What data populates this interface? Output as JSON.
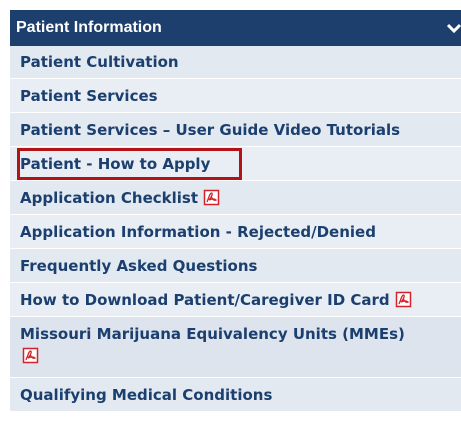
{
  "header": {
    "title": "Patient Information"
  },
  "menu": {
    "items": [
      {
        "label": "Patient Cultivation"
      },
      {
        "label": "Patient Services"
      },
      {
        "label": "Patient Services – User Guide Video Tutorials"
      },
      {
        "label": "Patient - How to Apply",
        "highlighted": true
      },
      {
        "label": "Application Checklist",
        "icon": "pdf-icon"
      },
      {
        "label": "Application Information - Rejected/Denied"
      },
      {
        "label": "Frequently Asked Questions"
      },
      {
        "label": "How to Download Patient/Caregiver ID Card",
        "icon": "pdf-icon"
      },
      {
        "label": "Missouri Marijuana Equivalency Units (MMEs)",
        "icon": "pdf-icon"
      },
      {
        "label": "Qualifying Medical Conditions"
      }
    ]
  },
  "colors": {
    "header_background": "#1d3f6d",
    "item_text": "#1b3f6e",
    "highlight_border": "#b31217",
    "pdf_icon": "#d2232a"
  }
}
